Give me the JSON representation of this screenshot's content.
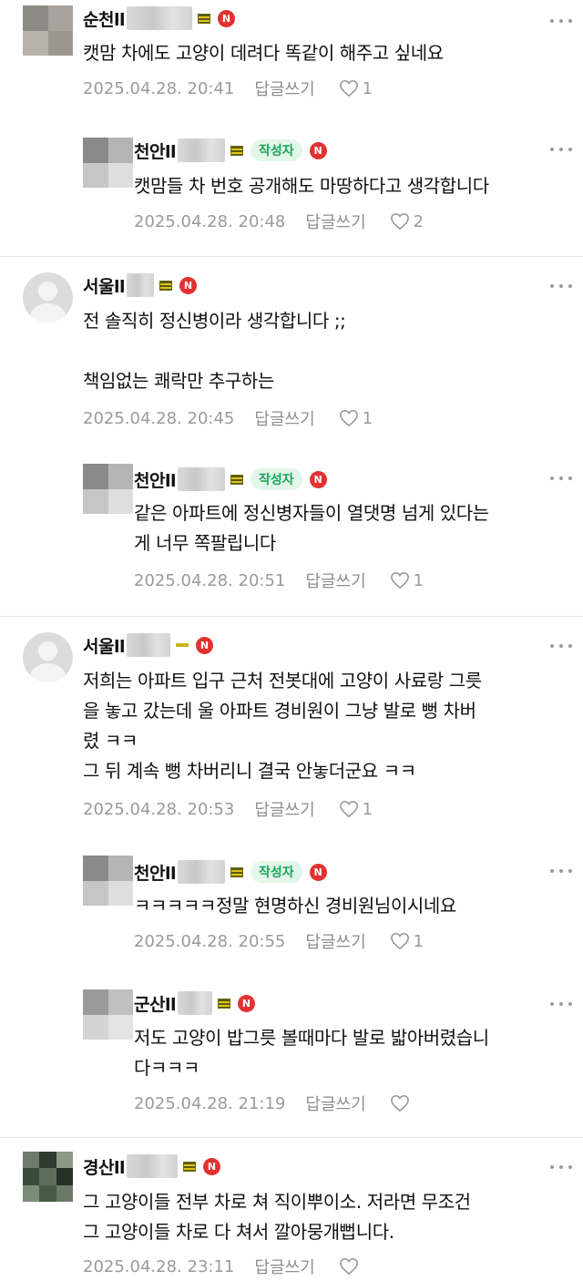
{
  "comments": [
    {
      "nick": "순천ll",
      "text": "캣맘 차에도 고양이 데려다 똑같이 해주고 싶네요",
      "date": "2025.04.28. 20:41",
      "reply": "답글쓰기",
      "likes": "1",
      "writer": "",
      "n": "N"
    },
    {
      "nick": "천안ll",
      "text": "캣맘들 차 번호 공개해도 마땅하다고 생각합니다",
      "date": "2025.04.28. 20:48",
      "reply": "답글쓰기",
      "likes": "2",
      "writer": "작성자",
      "n": "N"
    },
    {
      "nick": "서울ll",
      "text": "전 솔직히 정신병이라 생각합니다 ;;\n\n책임없는 쾌락만 추구하는",
      "date": "2025.04.28. 20:45",
      "reply": "답글쓰기",
      "likes": "1",
      "writer": "",
      "n": "N"
    },
    {
      "nick": "천안ll",
      "text": "같은 아파트에 정신병자들이 열댓명 넘게 있다는\n게 너무 쪽팔립니다",
      "date": "2025.04.28. 20:51",
      "reply": "답글쓰기",
      "likes": "1",
      "writer": "작성자",
      "n": "N"
    },
    {
      "nick": "서울ll",
      "text": "저희는 아파트 입구 근처 전봇대에 고양이 사료랑 그릇\n을 놓고 갔는데 울 아파트 경비원이 그냥 발로 뻥 차버\n렸 ㅋㅋ\n그 뒤 계속 뻥 차버리니 결국 안놓더군요 ㅋㅋ",
      "date": "2025.04.28. 20:53",
      "reply": "답글쓰기",
      "likes": "1",
      "writer": "",
      "n": "N"
    },
    {
      "nick": "천안ll",
      "text": "ㅋㅋㅋㅋㅋ정말 현명하신 경비원님이시네요",
      "date": "2025.04.28. 20:55",
      "reply": "답글쓰기",
      "likes": "1",
      "writer": "작성자",
      "n": "N"
    },
    {
      "nick": "군산ll",
      "text": "저도 고양이 밥그릇 볼때마다 발로 밟아버렸습니\n다ㅋㅋㅋ",
      "date": "2025.04.28. 21:19",
      "reply": "답글쓰기",
      "likes": "",
      "writer": "",
      "n": "N"
    },
    {
      "nick": "경산ll",
      "text": "그 고양이들 전부 차로 쳐 직이뿌이소. 저라면 무조건\n그 고양이들 차로 다 쳐서 깔아뭉개뻡니다.",
      "date": "2025.04.28. 23:11",
      "reply": "답글쓰기",
      "likes": "",
      "writer": "",
      "n": "N"
    }
  ]
}
